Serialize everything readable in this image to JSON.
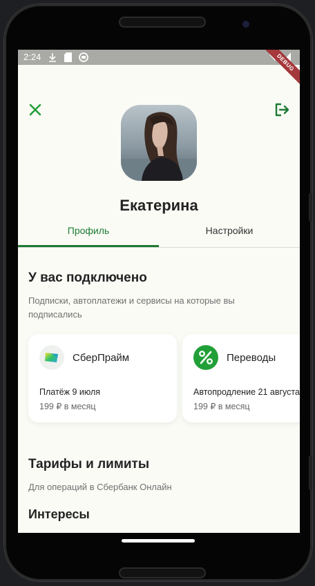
{
  "statusbar": {
    "time": "2:24",
    "debug": "DEBUG"
  },
  "profile": {
    "name": "Екатерина"
  },
  "tabs": [
    {
      "label": "Профиль",
      "active": true
    },
    {
      "label": "Настройки",
      "active": false
    }
  ],
  "connected": {
    "title": "У вас подключено",
    "description_line1": "Подписки, автоплатежи и сервисы на которые вы",
    "description_line2": "подписались",
    "cards": [
      {
        "title": "СберПрайм",
        "line1": "Платёж 9 июля",
        "line2": "199 ₽ в месяц",
        "icon": "sberprime-icon"
      },
      {
        "title": "Переводы",
        "line1": "Автопродление 21 августа",
        "line2": "199 ₽ в месяц",
        "icon": "percent-icon"
      }
    ]
  },
  "tariffs": {
    "title": "Тарифы и лимиты",
    "description": "Для операций в Сбербанк Онлайн"
  },
  "interests": {
    "title": "Интересы"
  },
  "colors": {
    "accent": "#1d7a34",
    "background": "#fafbf5",
    "percent_icon_bg": "#21a038"
  }
}
